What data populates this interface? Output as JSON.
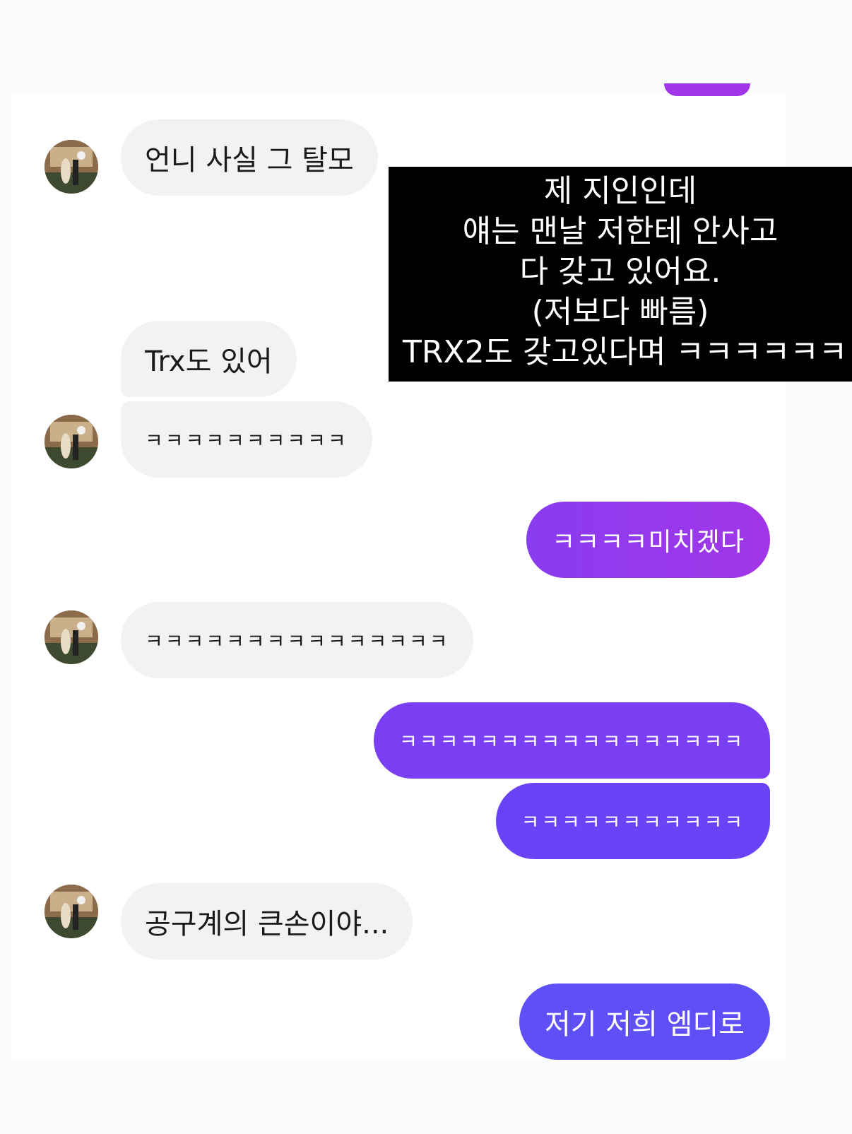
{
  "colors": {
    "incoming_bg": "#f2f2f4",
    "outgoing_gradient": [
      "#a136e8",
      "#7c3ff2",
      "#6a4af6"
    ],
    "overlay_bg": "#000000"
  },
  "messages": [
    {
      "side": "incoming",
      "text": "언니 사실 그 탈모",
      "avatar": true
    },
    {
      "side": "incoming",
      "text": "Trx도 있어",
      "avatar": false
    },
    {
      "side": "incoming",
      "text": "ㅋㅋㅋㅋㅋㅋㅋㅋㅋㅋ",
      "avatar": true
    },
    {
      "side": "outgoing",
      "text": "ㅋㅋㅋㅋ미치겠다"
    },
    {
      "side": "incoming",
      "text": "ㅋㅋㅋㅋㅋㅋㅋㅋㅋㅋㅋㅋㅋㅋㅋ",
      "avatar": true
    },
    {
      "side": "outgoing",
      "text": "ㅋㅋㅋㅋㅋㅋㅋㅋㅋㅋㅋㅋㅋㅋㅋㅋㅋ"
    },
    {
      "side": "outgoing",
      "text": "ㅋㅋㅋㅋㅋㅋㅋㅋㅋㅋㅋ"
    },
    {
      "side": "incoming",
      "text": "공구계의 큰손이야...",
      "avatar": true
    },
    {
      "side": "outgoing",
      "text": "저기 저희 엠디로"
    }
  ],
  "overlay": {
    "lines": [
      "제 지인인데",
      "얘는 맨날 저한테 안사고",
      "다 갖고 있어요.",
      "(저보다 빠름)",
      "TRX2도 갖고있다며 ㅋㅋㅋㅋㅋㅋ"
    ]
  }
}
